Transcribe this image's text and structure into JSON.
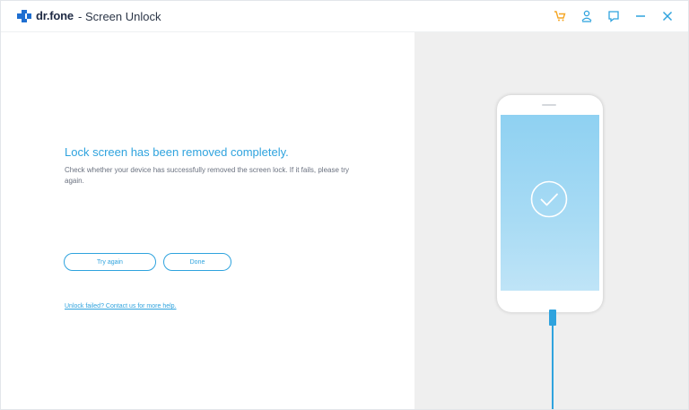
{
  "app": {
    "brand": "dr.fone",
    "title": "- Screen Unlock"
  },
  "titlebar": {
    "icons": [
      "cart-icon",
      "user-icon",
      "feedback-icon",
      "minimize-icon",
      "close-icon"
    ]
  },
  "result": {
    "headline": "Lock screen has been removed completely.",
    "description": "Check whether your device has successfully removed the screen lock. If it fails, please try again.",
    "try_again_label": "Try again",
    "done_label": "Done",
    "help_link": "Unlock failed? Contact us for more help."
  },
  "colors": {
    "accent": "#2fa3de",
    "cart": "#f5a623",
    "screen": "#a8dbf4",
    "panel": "#efefef"
  }
}
